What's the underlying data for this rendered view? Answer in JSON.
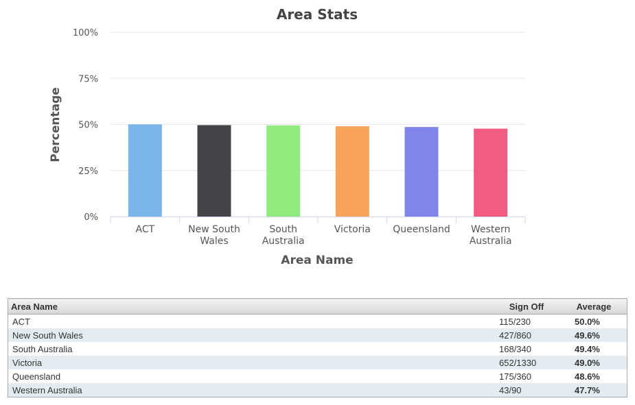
{
  "chart_data": {
    "type": "bar",
    "title": "Area Stats",
    "xlabel": "Area Name",
    "ylabel": "Percentage",
    "categories": [
      "ACT",
      "New South Wales",
      "South Australia",
      "Victoria",
      "Queensland",
      "Western Australia"
    ],
    "category_lines": [
      [
        "ACT"
      ],
      [
        "New South",
        "Wales"
      ],
      [
        "South",
        "Australia"
      ],
      [
        "Victoria"
      ],
      [
        "Queensland"
      ],
      [
        "Western",
        "Australia"
      ]
    ],
    "values": [
      50.0,
      49.6,
      49.4,
      49.0,
      48.6,
      47.7
    ],
    "colors": [
      "#7cb5ec",
      "#434348",
      "#90ed7d",
      "#f7a35c",
      "#8085e9",
      "#f15c80"
    ],
    "ylim": [
      0,
      100
    ],
    "yticks": [
      0,
      25,
      50,
      75,
      100
    ],
    "ytick_labels": [
      "0%",
      "25%",
      "50%",
      "75%",
      "100%"
    ],
    "grid": true,
    "legend": "none"
  },
  "table": {
    "headers": {
      "area": "Area Name",
      "sign_off": "Sign Off",
      "average": "Average"
    },
    "rows": [
      {
        "area": "ACT",
        "sign_off": "115/230",
        "average": "50.0%"
      },
      {
        "area": "New South Wales",
        "sign_off": "427/860",
        "average": "49.6%"
      },
      {
        "area": "South Australia",
        "sign_off": "168/340",
        "average": "49.4%"
      },
      {
        "area": "Victoria",
        "sign_off": "652/1330",
        "average": "49.0%"
      },
      {
        "area": "Queensland",
        "sign_off": "175/360",
        "average": "48.6%"
      },
      {
        "area": "Western Australia",
        "sign_off": "43/90",
        "average": "47.7%"
      }
    ]
  }
}
